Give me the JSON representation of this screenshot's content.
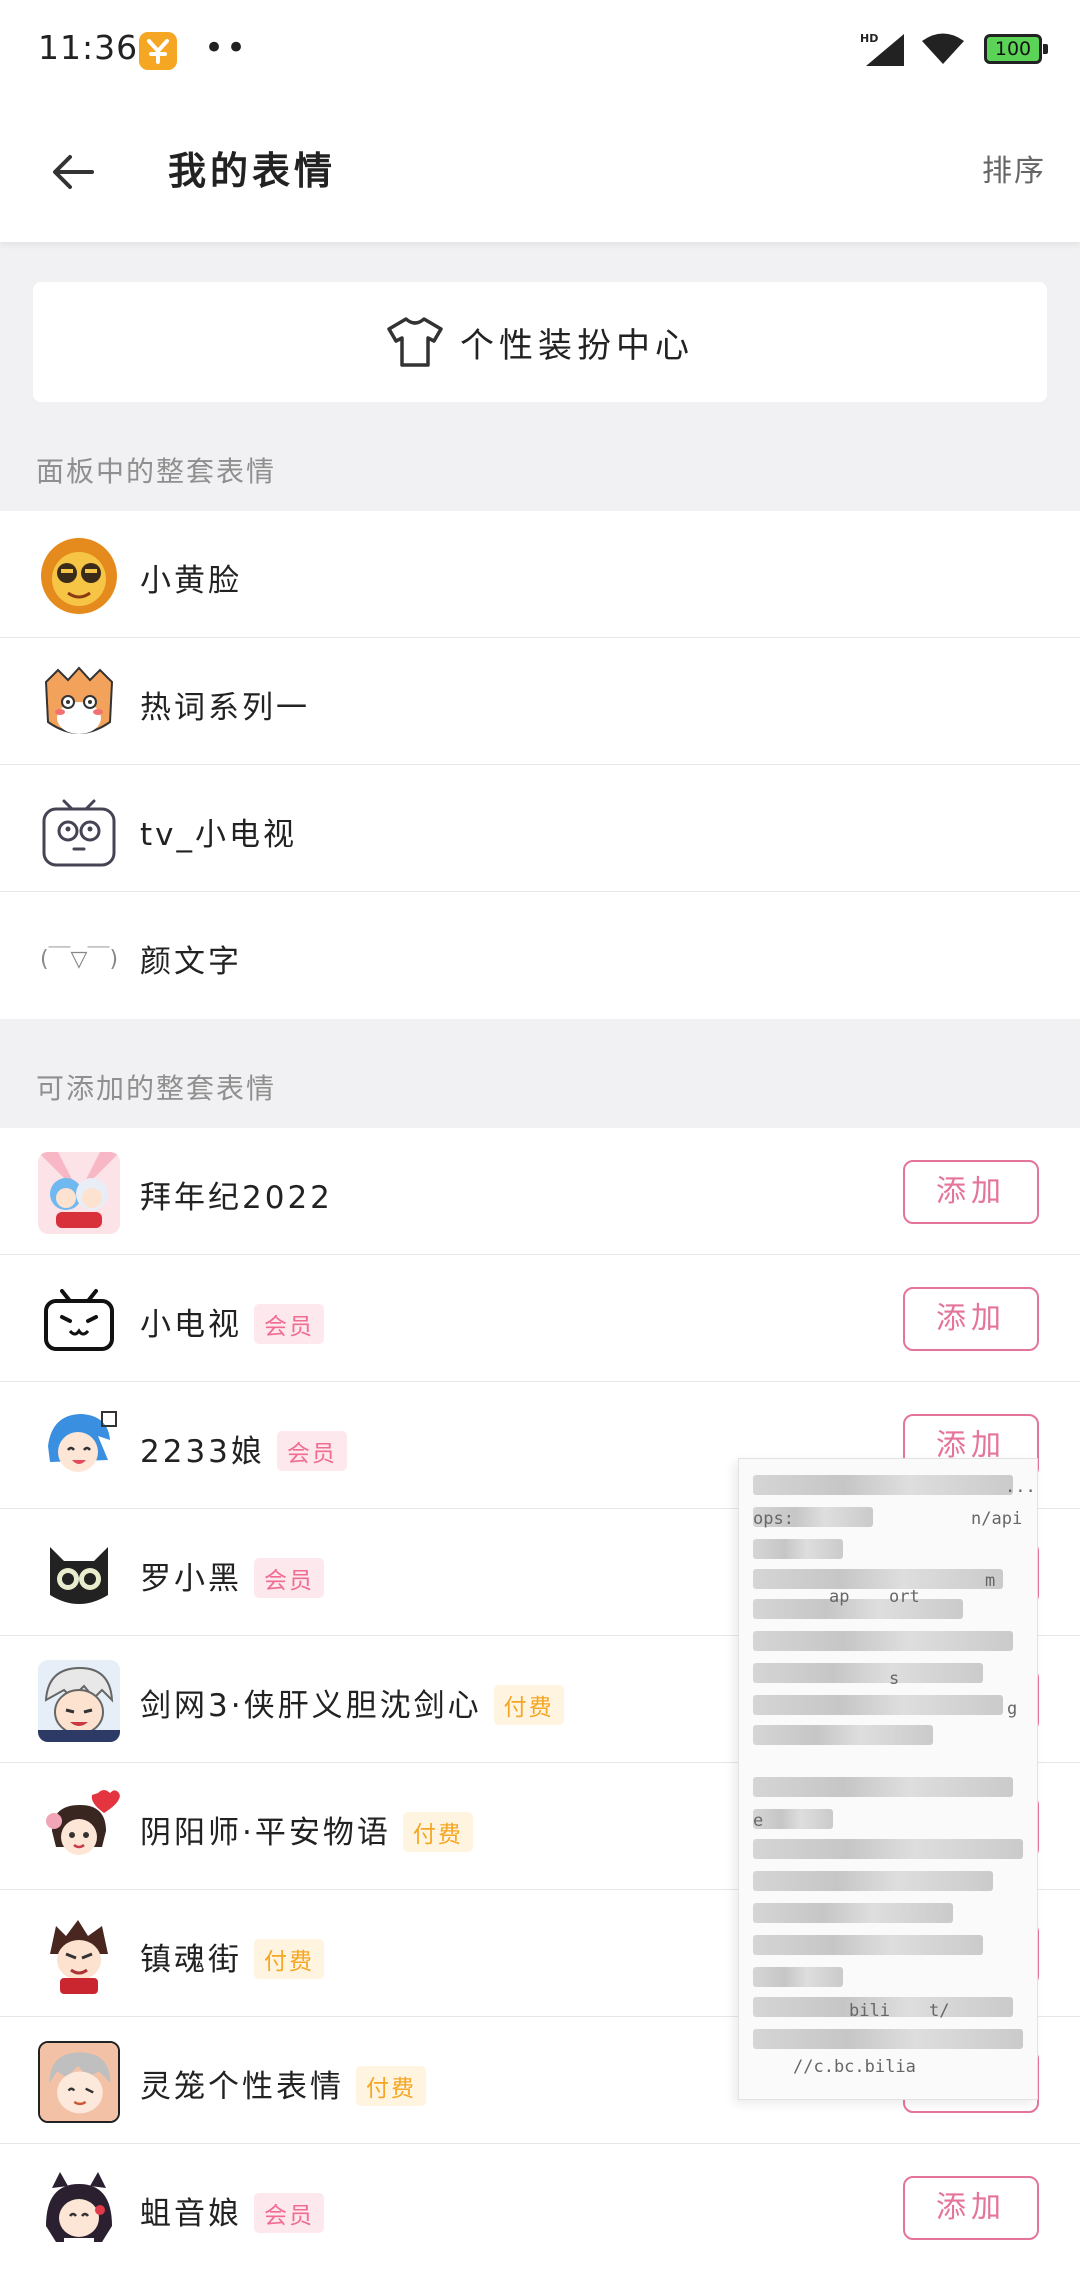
{
  "status_bar": {
    "time": "11:36",
    "more": "••",
    "network": "HD",
    "battery": "100"
  },
  "header": {
    "title": "我的表情",
    "sort_label": "排序"
  },
  "dress_center": {
    "label": "个性装扮中心"
  },
  "panel_section": {
    "title": "面板中的整套表情",
    "items": [
      {
        "name": "小黄脸",
        "icon": "lion-face-icon"
      },
      {
        "name": "热词系列一",
        "icon": "tiger-face-icon"
      },
      {
        "name": "tv_小电视",
        "icon": "tv-face-icon"
      },
      {
        "name": "颜文字",
        "icon": "kaomoji-icon",
        "kaomoji": "(￣▽￣)"
      }
    ]
  },
  "addable_section": {
    "title": "可添加的整套表情",
    "add_label": "添加",
    "items": [
      {
        "name": "拜年纪2022",
        "badge": "",
        "icon": "new-year-girls-icon"
      },
      {
        "name": "小电视",
        "badge": "会员",
        "icon": "bilibili-tv-icon"
      },
      {
        "name": "2233娘",
        "badge": "会员",
        "icon": "2233-girl-icon"
      },
      {
        "name": "罗小黑",
        "badge": "会员",
        "icon": "black-cat-icon"
      },
      {
        "name": "剑网3·侠肝义胆沈剑心",
        "badge": "付费",
        "icon": "jx3-character-icon"
      },
      {
        "name": "阴阳师·平安物语",
        "badge": "付费",
        "icon": "onmyoji-character-icon"
      },
      {
        "name": "镇魂街",
        "badge": "付费",
        "icon": "zhenhunjie-character-icon"
      },
      {
        "name": "灵笼个性表情",
        "badge": "付费",
        "icon": "linglong-character-icon"
      },
      {
        "name": "蛆音娘",
        "badge": "会员",
        "icon": "qiyin-girl-icon"
      }
    ]
  },
  "overlay": {
    "fragments": [
      "...",
      "ops:",
      "n/api",
      "m",
      "ap",
      "ort",
      "s",
      "g",
      "e",
      "bili",
      "t/",
      "//c.bc.bilia"
    ]
  },
  "colors": {
    "accent": "#e5749a",
    "vip_badge": "#f06c93",
    "paid_badge": "#f5a623",
    "section_bg": "#f1f1f3"
  }
}
